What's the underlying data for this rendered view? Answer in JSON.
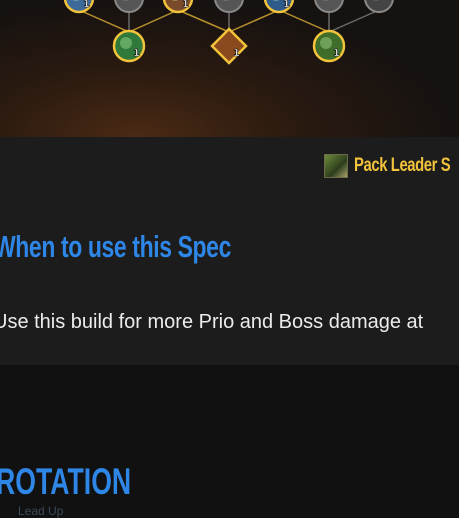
{
  "talent_tree": {
    "nodes": [
      {
        "name": "top-node-1",
        "icon": "frost-arrow-icon",
        "rank": "1",
        "active": true
      },
      {
        "name": "top-node-2",
        "icon": "trap-icon",
        "rank": "",
        "active": false
      },
      {
        "name": "top-node-3",
        "icon": "beast-icon",
        "rank": "1",
        "active": true
      },
      {
        "name": "top-node-4",
        "icon": "paw-icon",
        "rank": "",
        "active": false
      },
      {
        "name": "top-node-5",
        "icon": "hawk-icon",
        "rank": "1",
        "active": true
      },
      {
        "name": "top-node-6",
        "icon": "claw-icon",
        "rank": "",
        "active": false
      },
      {
        "name": "top-node-7",
        "icon": "shadow-icon",
        "rank": "",
        "active": false
      },
      {
        "name": "bottom-node-1",
        "icon": "poison-icon",
        "rank": "1",
        "active": true
      },
      {
        "name": "bottom-node-2",
        "icon": "crossbow-icon",
        "rank": "1",
        "active": true
      },
      {
        "name": "bottom-node-3",
        "icon": "wyvern-icon",
        "rank": "1",
        "active": true
      }
    ]
  },
  "talent_link": {
    "icon": "pack-leader-icon",
    "label": "Pack Leader S"
  },
  "section": {
    "heading": "When to use this Spec",
    "paragraph": "Use this build for more Prio and Boss damage at"
  },
  "next_section": {
    "heading": "ROTATION",
    "partial_text": "Lead Up"
  },
  "colors": {
    "heading_blue": "#2e86e6",
    "gold": "#f2c33b",
    "band": "#1c1c1c",
    "background": "#111111"
  }
}
